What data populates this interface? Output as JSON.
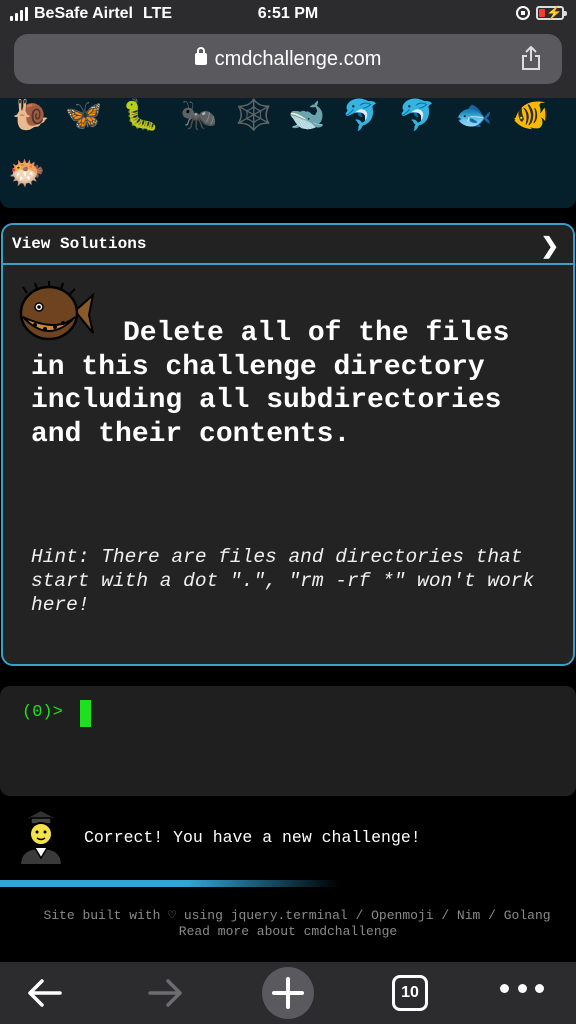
{
  "status_bar": {
    "carrier": "BeSafe Airtel",
    "network": "LTE",
    "time": "6:51 PM"
  },
  "browser": {
    "url": "cmdchallenge.com",
    "tab_count": "10",
    "icons": [
      "lock-icon",
      "share-icon",
      "back-icon",
      "forward-icon",
      "new-tab-icon",
      "tabs-icon",
      "more-icon"
    ]
  },
  "emoji_strip": {
    "emojis": [
      "🐌",
      "🦋",
      "🐛",
      "🐜",
      "🕸️",
      "🐋",
      "🐬",
      "🐬",
      "🐟",
      "🐠",
      "🐡"
    ]
  },
  "challenge_panel": {
    "view_solutions_label": "View Solutions",
    "chevron": "❯",
    "description": "Delete all of the files in this challenge directory including all subdirectories and their contents.",
    "hint": "Hint: There are files and directories that start with a dot \".\", \"rm -rf *\" won't work here!"
  },
  "terminal": {
    "prompt": "(0)>"
  },
  "message": {
    "text": "Correct! You have a new challenge!"
  },
  "footer": {
    "line1": "Site built with ♡ using jquery.terminal / Openmoji / Nim / Golang",
    "line2": "Read more about cmdchallenge"
  },
  "colors": {
    "accent": "#3aa0c8",
    "terminal_green": "#1ee01e",
    "battery_low": "#ff3b30"
  }
}
